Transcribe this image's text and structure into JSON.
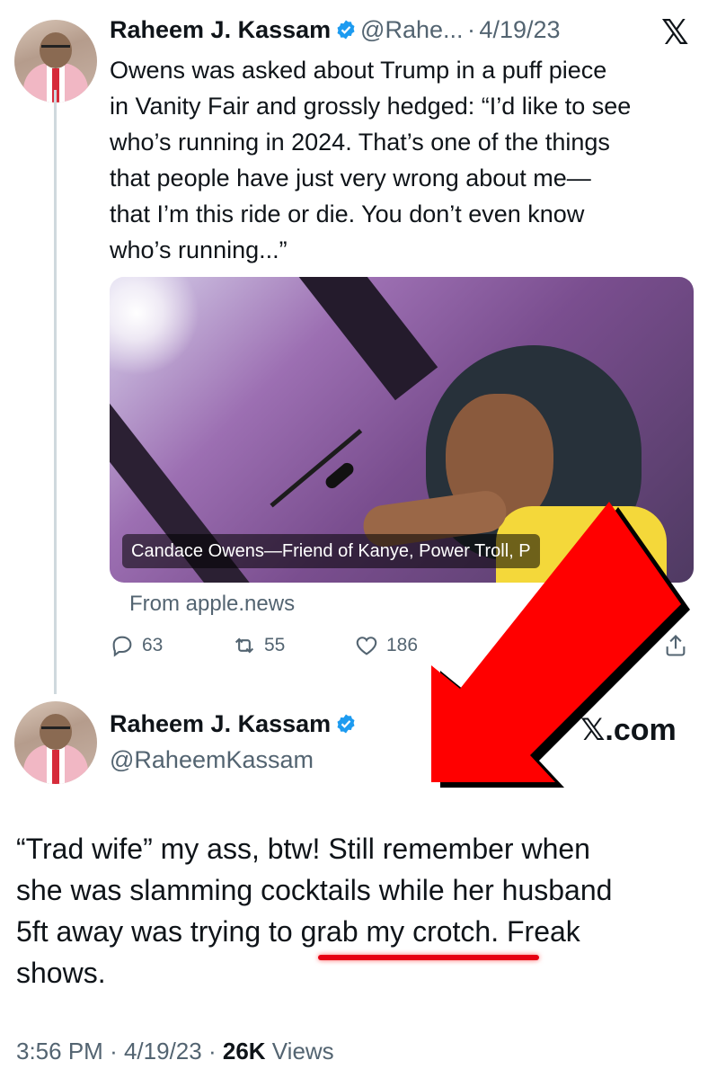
{
  "tweet1": {
    "author_name": "Raheem J. Kassam",
    "handle": "@Rahe...",
    "date": "4/19/23",
    "text_lines": [
      "Owens was asked about Trump in a puff piece",
      "in Vanity Fair and grossly hedged: “I’d like to see",
      "who’s running in 2024. That’s one of the things",
      "that people have just very wrong about me—",
      "that I’m this ride or die. You don’t even know",
      "who’s running...”"
    ],
    "card_caption": "Candace Owens—Friend of Kanye, Power Troll, P",
    "card_source": "From apple.news",
    "replies": "63",
    "reposts": "55",
    "likes": "186"
  },
  "brand": {
    "corner_logo": "𝕏",
    "watermark": "𝕏.com"
  },
  "tweet2": {
    "author_name": "Raheem J. Kassam",
    "handle": "@RaheemKassam",
    "text_lines": [
      "“Trad wife” my ass, btw! Still remember when",
      "she was slamming cocktails while her husband",
      "5ft away was trying to grab my crotch. Freak",
      "shows."
    ],
    "time": "3:56 PM",
    "date": "4/19/23",
    "views_count": "26K",
    "views_label": "Views"
  },
  "colors": {
    "verified": "#1d9bf0",
    "annotation_red": "#ff0000",
    "muted": "#536471"
  },
  "icons": [
    "verified-badge-icon",
    "x-logo-icon",
    "reply-icon",
    "repost-icon",
    "like-icon",
    "share-icon",
    "red-arrow-annotation"
  ]
}
